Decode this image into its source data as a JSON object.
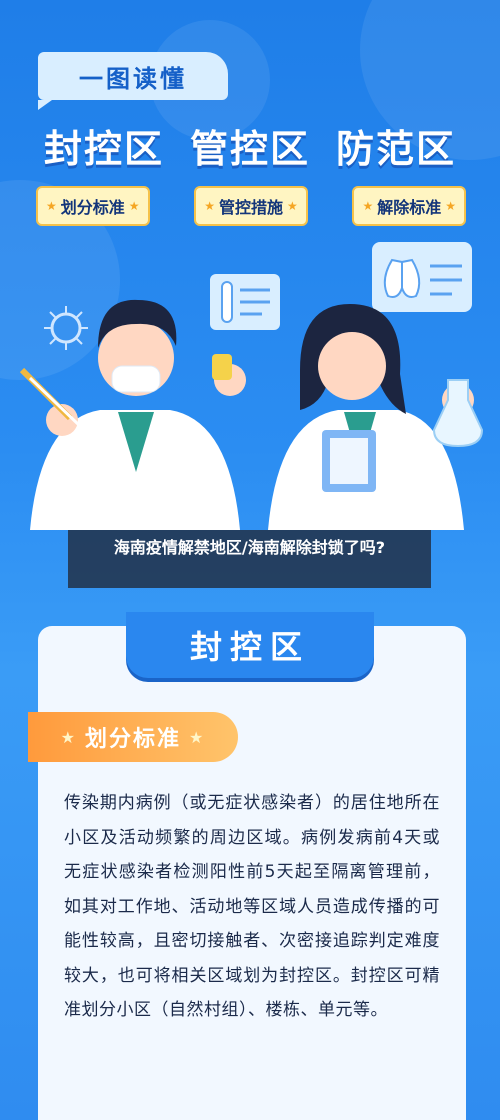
{
  "tag": "一图读懂",
  "headline": [
    "封控区",
    "管控区",
    "防范区"
  ],
  "pills": [
    "划分标准",
    "管控措施",
    "解除标准"
  ],
  "caption": "海南疫情解禁地区/海南解除封锁了吗?",
  "card": {
    "title": "封控区",
    "subtitle": "划分标准",
    "body": "传染期内病例（或无症状感染者）的居住地所在小区及活动频繁的周边区域。病例发病前4天或无症状感染者检测阳性前5天起至隔离管理前，如其对工作地、活动地等区域人员造成传播的可能性较高，且密切接触者、次密接追踪判定难度较大，也可将相关区域划为封控区。封控区可精准划分小区（自然村组）、楼栋、单元等。"
  }
}
